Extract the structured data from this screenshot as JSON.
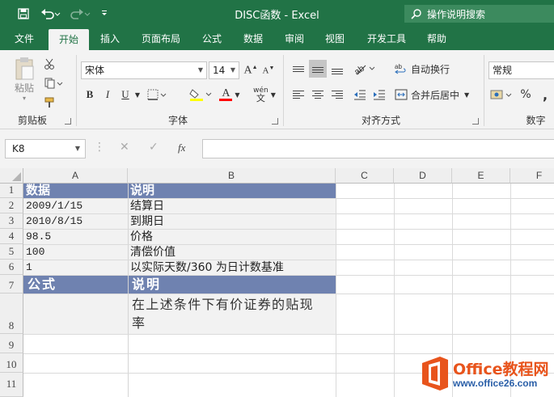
{
  "titlebar": {
    "title": "DISC函数  -  Excel",
    "tell_me": "操作说明搜索"
  },
  "tabs": [
    {
      "label": "文件"
    },
    {
      "label": "开始"
    },
    {
      "label": "插入"
    },
    {
      "label": "页面布局"
    },
    {
      "label": "公式"
    },
    {
      "label": "数据"
    },
    {
      "label": "审阅"
    },
    {
      "label": "视图"
    },
    {
      "label": "开发工具"
    },
    {
      "label": "帮助"
    }
  ],
  "active_tab": "开始",
  "ribbon": {
    "clipboard": {
      "paste": "粘贴",
      "label": "剪贴板"
    },
    "font": {
      "name": "宋体",
      "size": "14",
      "label": "字体",
      "bold": "B",
      "italic": "I",
      "underline": "U",
      "font_color_glyph": "A",
      "phonetic": "wén"
    },
    "alignment": {
      "wrap": "自动换行",
      "merge": "合并后居中",
      "label": "对齐方式"
    },
    "number": {
      "format": "常规",
      "percent": "%",
      "comma": ",",
      "label": "数字"
    }
  },
  "formula_bar": {
    "name_box": "K8",
    "fx": "fx",
    "formula": ""
  },
  "sheet": {
    "columns": [
      "A",
      "B",
      "C",
      "D",
      "E",
      "F"
    ],
    "rows": [
      "1",
      "2",
      "3",
      "4",
      "5",
      "6",
      "7",
      "8",
      "9",
      "10",
      "11"
    ],
    "header1": {
      "a": "数据",
      "b": "说明"
    },
    "data": [
      {
        "a": "2009/1/15",
        "b": "结算日"
      },
      {
        "a": "2010/8/15",
        "b": "到期日"
      },
      {
        "a": "98.5",
        "b": "价格"
      },
      {
        "a": "100",
        "b": "清偿价值"
      },
      {
        "a": "1",
        "b": "以实际天数/360 为日计数基准"
      }
    ],
    "header2": {
      "a": "公式",
      "b": "说明"
    },
    "row8_b": [
      "在上述条件下有价证券的贴现",
      "率"
    ]
  },
  "colors": {
    "excel_green": "#217346",
    "header_band": "#6f82b0",
    "data_band": "#f2f2f2"
  },
  "watermark": {
    "brand": "Office教程网",
    "url": "www.office26.com"
  }
}
